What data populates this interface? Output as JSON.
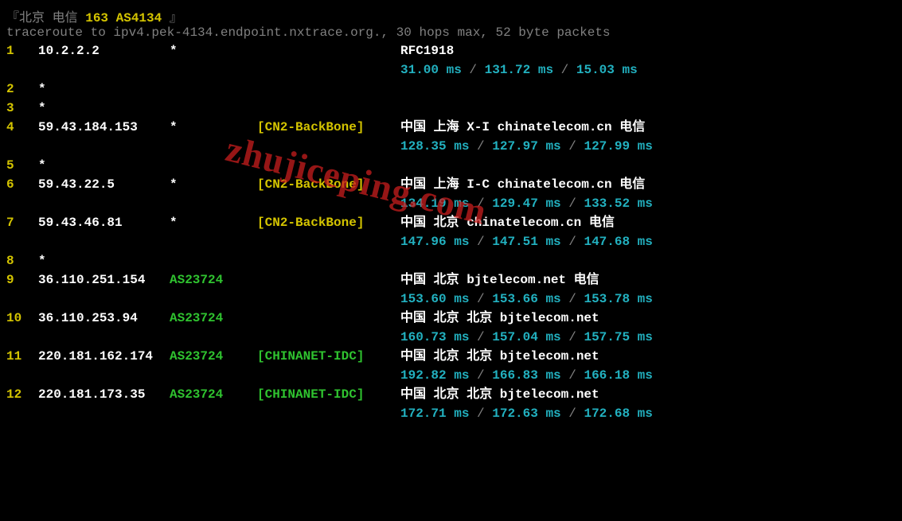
{
  "header": {
    "prefix": "『北京 电信 ",
    "highlight": "163 AS4134",
    "suffix": " 』"
  },
  "cmd": "traceroute to ipv4.pek-4134.endpoint.nxtrace.org., 30 hops max, 52 byte packets",
  "hops": [
    {
      "n": "1",
      "ip": "10.2.2.2",
      "as": "*",
      "asClass": "as-star",
      "tag": "",
      "tagClass": "",
      "loc": "RFC1918",
      "t1": "31.00 ms",
      "t2": "131.72 ms",
      "t3": "15.03 ms"
    },
    {
      "n": "2",
      "ip": "*",
      "as": "",
      "asClass": "",
      "tag": "",
      "tagClass": "",
      "loc": "",
      "t1": "",
      "t2": "",
      "t3": ""
    },
    {
      "n": "3",
      "ip": "*",
      "as": "",
      "asClass": "",
      "tag": "",
      "tagClass": "",
      "loc": "",
      "t1": "",
      "t2": "",
      "t3": ""
    },
    {
      "n": "4",
      "ip": "59.43.184.153",
      "as": "*",
      "asClass": "as-star",
      "tag": "[CN2-BackBone]",
      "tagClass": "tag-yellow",
      "loc": "中国 上海  X-I chinatelecom.cn  电信",
      "t1": "128.35 ms",
      "t2": "127.97 ms",
      "t3": "127.99 ms"
    },
    {
      "n": "5",
      "ip": "*",
      "as": "",
      "asClass": "",
      "tag": "",
      "tagClass": "",
      "loc": "",
      "t1": "",
      "t2": "",
      "t3": ""
    },
    {
      "n": "6",
      "ip": "59.43.22.5",
      "as": "*",
      "asClass": "as-star",
      "tag": "[CN2-BackBone]",
      "tagClass": "tag-yellow",
      "loc": "中国 上海  I-C chinatelecom.cn  电信",
      "t1": "134.19 ms",
      "t2": "129.47 ms",
      "t3": "133.52 ms"
    },
    {
      "n": "7",
      "ip": "59.43.46.81",
      "as": "*",
      "asClass": "as-star",
      "tag": "[CN2-BackBone]",
      "tagClass": "tag-yellow",
      "loc": "中国 北京   chinatelecom.cn  电信",
      "t1": "147.96 ms",
      "t2": "147.51 ms",
      "t3": "147.68 ms"
    },
    {
      "n": "8",
      "ip": "*",
      "as": "",
      "asClass": "",
      "tag": "",
      "tagClass": "",
      "loc": "",
      "t1": "",
      "t2": "",
      "t3": ""
    },
    {
      "n": "9",
      "ip": "36.110.251.154",
      "as": "AS23724",
      "asClass": "as-green",
      "tag": "",
      "tagClass": "",
      "loc": "中国 北京   bjtelecom.net  电信",
      "t1": "153.60 ms",
      "t2": "153.66 ms",
      "t3": "153.78 ms"
    },
    {
      "n": "10",
      "ip": "36.110.253.94",
      "as": "AS23724",
      "asClass": "as-green",
      "tag": "",
      "tagClass": "",
      "loc": "中国 北京 北京  bjtelecom.net",
      "t1": "160.73 ms",
      "t2": "157.04 ms",
      "t3": "157.75 ms"
    },
    {
      "n": "11",
      "ip": "220.181.162.174",
      "as": "AS23724",
      "asClass": "as-green",
      "tag": "[CHINANET-IDC]",
      "tagClass": "tag-green",
      "loc": "中国 北京 北京  bjtelecom.net",
      "t1": "192.82 ms",
      "t2": "166.83 ms",
      "t3": "166.18 ms"
    },
    {
      "n": "12",
      "ip": "220.181.173.35",
      "as": "AS23724",
      "asClass": "as-green",
      "tag": "[CHINANET-IDC]",
      "tagClass": "tag-green",
      "loc": "中国 北京 北京  bjtelecom.net",
      "t1": "172.71 ms",
      "t2": "172.63 ms",
      "t3": "172.68 ms"
    }
  ],
  "sep": " / ",
  "watermark": "zhujiceping.com"
}
